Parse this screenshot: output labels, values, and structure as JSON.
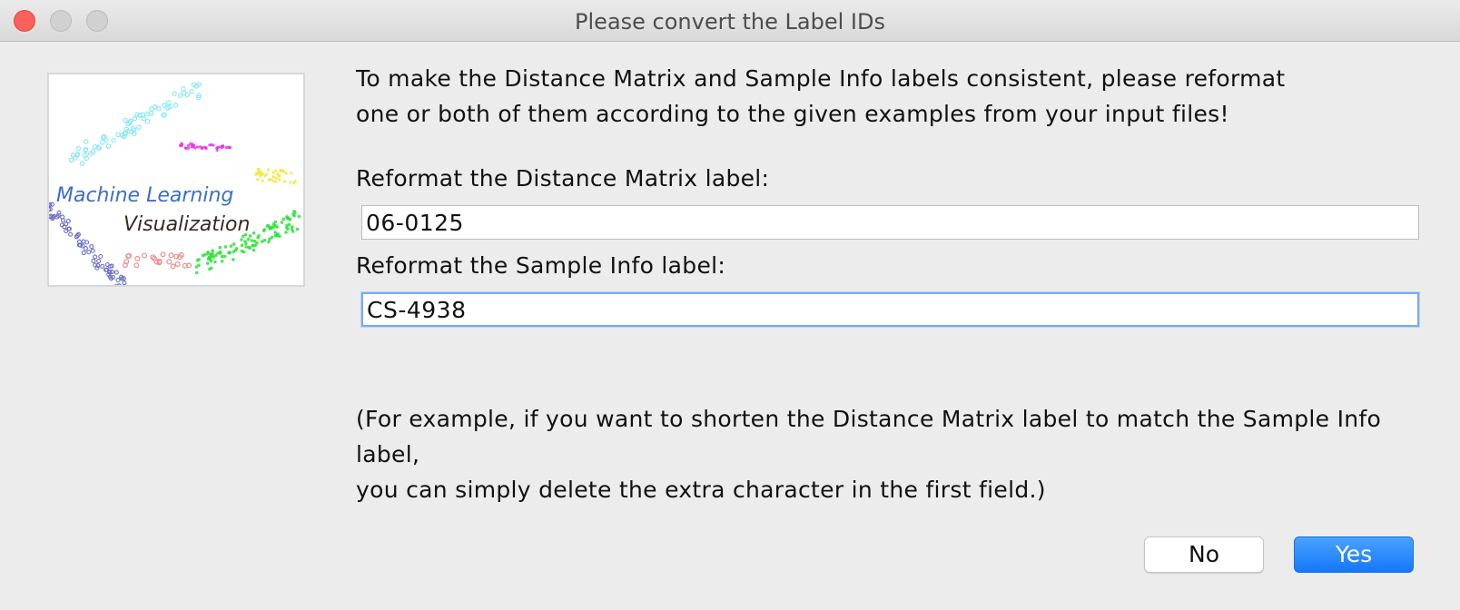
{
  "window": {
    "title": "Please convert the Label IDs"
  },
  "logo": {
    "line1": "Machine Learning",
    "line2": "Visualization",
    "colors": {
      "cyan": "#7fe8ef",
      "magenta": "#e23be0",
      "yellow": "#f4e63a",
      "green": "#2fe23a",
      "red": "#ef8a8a",
      "blue": "#5b5fc0",
      "title_blue": "#3b6fc8",
      "title_dark": "#3a2a1e"
    }
  },
  "message": {
    "line1": "To make the Distance Matrix and Sample Info labels consistent, please reformat",
    "line2": "one or both of them according to the given examples from your input files!"
  },
  "distance_matrix": {
    "label": "Reformat the Distance Matrix label:",
    "value": "06-0125"
  },
  "sample_info": {
    "label": "Reformat the Sample Info label:",
    "value": "CS-4938"
  },
  "note": {
    "line1": "(For example, if you want to shorten the Distance Matrix label to match the Sample Info label,",
    "line2": "you can simply delete the extra character in the first field.)"
  },
  "buttons": {
    "no": "No",
    "yes": "Yes"
  },
  "colors": {
    "accent": "#1577fb",
    "close": "#fc605c",
    "background": "#ececec"
  }
}
